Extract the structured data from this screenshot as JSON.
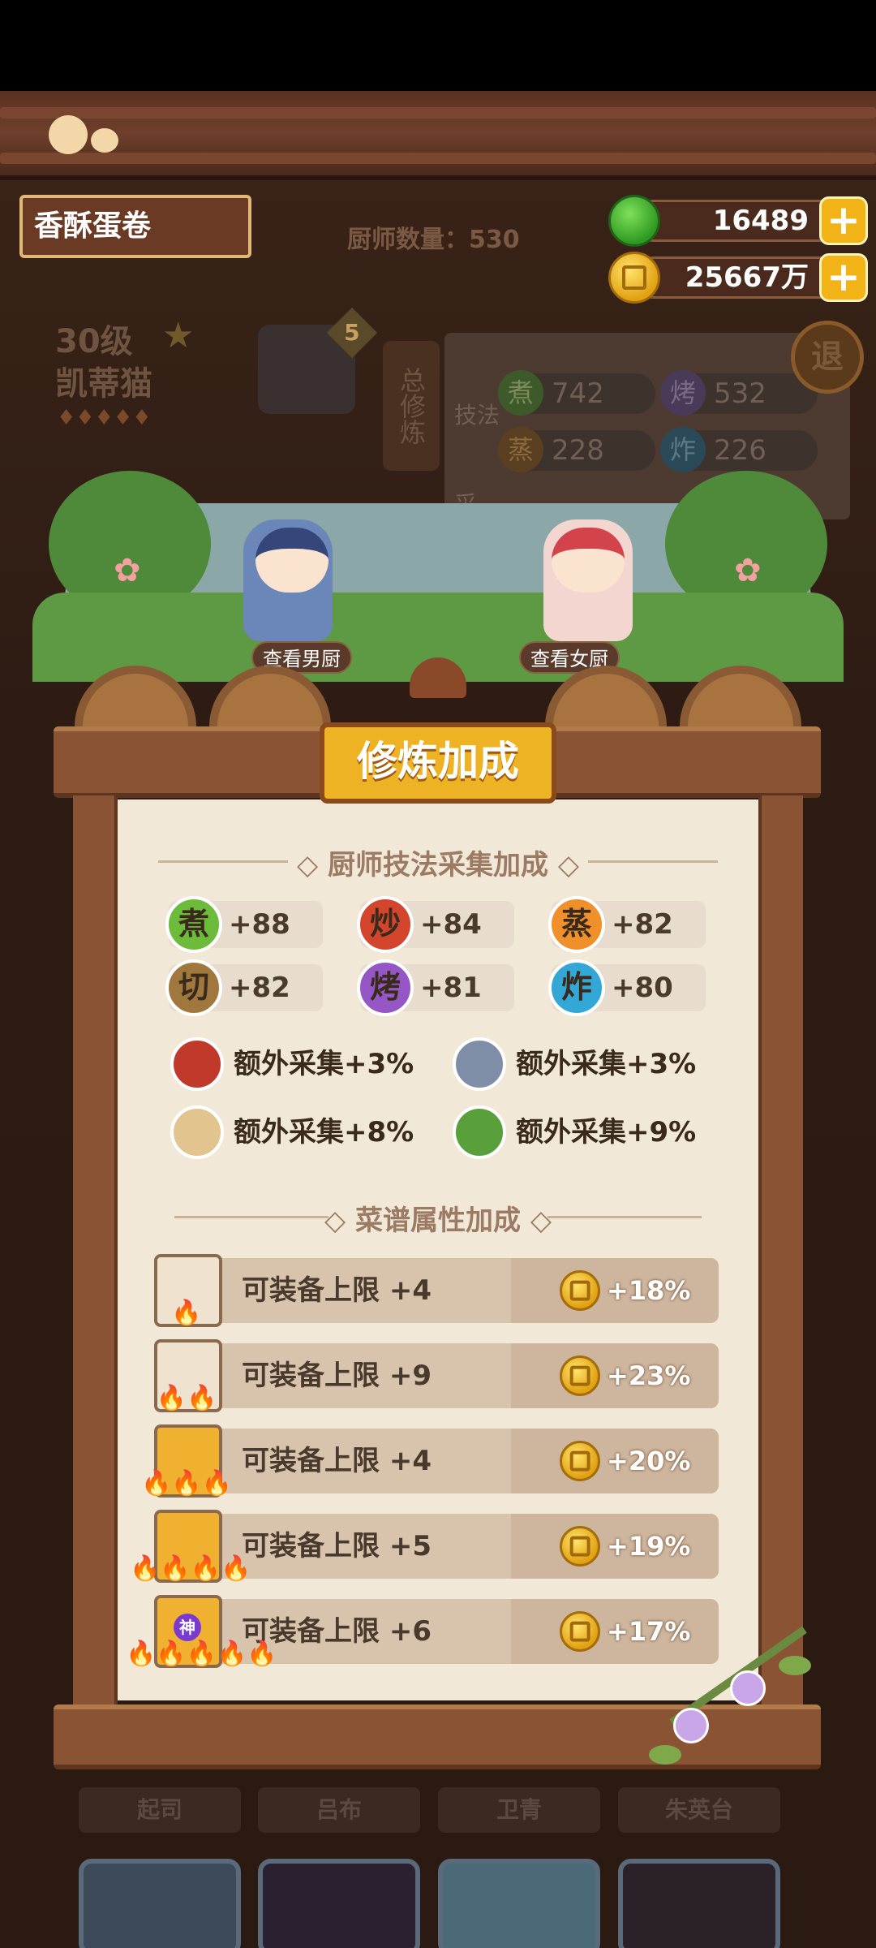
{
  "header": {
    "dish_name": "香酥蛋卷",
    "chef_count": "厨师数量：530",
    "gems": "16489",
    "coins": "25667万",
    "plus": "+"
  },
  "chef_info": {
    "level": "30级",
    "name": "凯蒂猫",
    "badge": "5",
    "total_training": "总修炼",
    "skill_label": "技法",
    "collect_label": "采",
    "back": "退"
  },
  "bg_skills": [
    {
      "icon": "煮",
      "value": "742"
    },
    {
      "icon": "烤",
      "value": "532"
    },
    {
      "icon": "蒸",
      "value": "228"
    },
    {
      "icon": "炸",
      "value": "226"
    }
  ],
  "garden": {
    "view_male": "查看男厨",
    "view_female": "查看女厨"
  },
  "panel": {
    "title": "修炼加成",
    "skills_title": "厨师技法采集加成",
    "recipes_title": "菜谱属性加成"
  },
  "skills": [
    {
      "icon": "煮",
      "value": "+88",
      "color": "#6dbb3a"
    },
    {
      "icon": "炒",
      "value": "+84",
      "color": "#d3452c"
    },
    {
      "icon": "蒸",
      "value": "+82",
      "color": "#f0902a"
    },
    {
      "icon": "切",
      "value": "+82",
      "color": "#a0783e"
    },
    {
      "icon": "烤",
      "value": "+81",
      "color": "#9457c5"
    },
    {
      "icon": "炸",
      "value": "+80",
      "color": "#33a7d6"
    }
  ],
  "extras": [
    {
      "icon": "meat-icon",
      "text": "额外采集+3%",
      "color": "#c0392b"
    },
    {
      "icon": "fish-icon",
      "text": "额外采集+3%",
      "color": "#7f8ea6"
    },
    {
      "icon": "flour-icon",
      "text": "额外采集+8%",
      "color": "#e2c58e"
    },
    {
      "icon": "vegetable-icon",
      "text": "额外采集+9%",
      "color": "#5aa03a"
    }
  ],
  "recipes": [
    {
      "label": "可装备上限 +4",
      "value": "+18%",
      "flames": "🔥"
    },
    {
      "label": "可装备上限 +9",
      "value": "+23%",
      "flames": "🔥🔥"
    },
    {
      "label": "可装备上限 +4",
      "value": "+20%",
      "flames": "🔥🔥🔥"
    },
    {
      "label": "可装备上限 +5",
      "value": "+19%",
      "flames": "🔥🔥🔥🔥"
    },
    {
      "label": "可装备上限 +6",
      "value": "+17%",
      "flames": "🔥🔥🔥🔥🔥",
      "badge": "神"
    }
  ],
  "bottom_names": [
    "起司",
    "吕布",
    "卫青",
    "朱英台"
  ]
}
